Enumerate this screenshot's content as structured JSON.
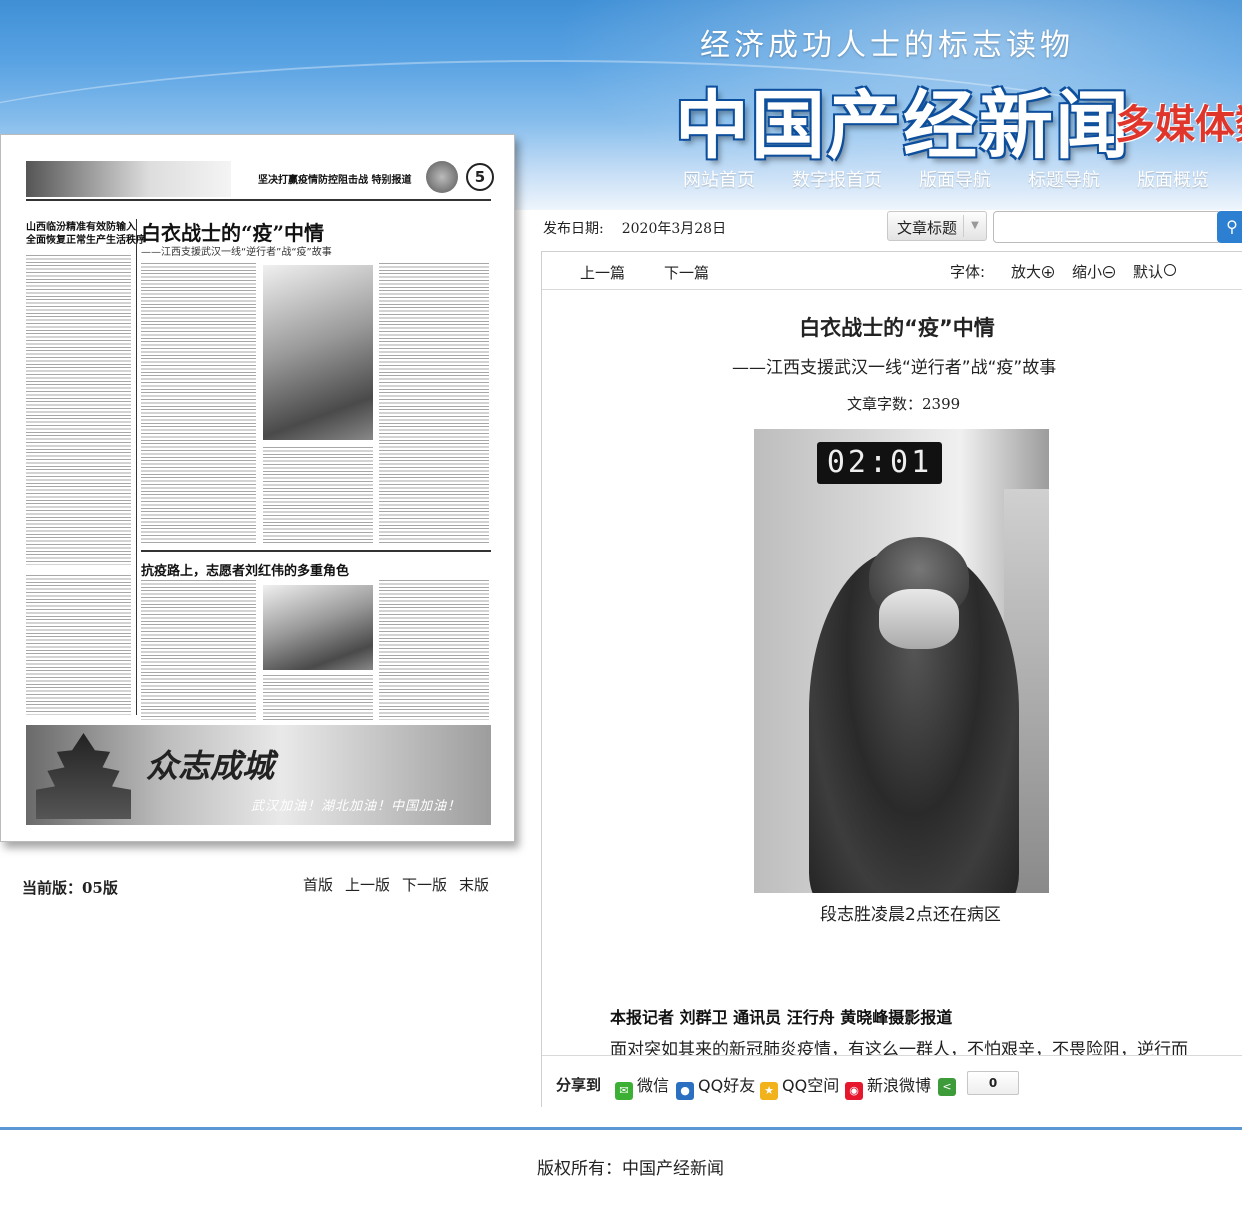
{
  "header": {
    "slogan": "经济成功人士的标志读物",
    "brand": "中国产经新闻",
    "brand_sub": "多媒体数",
    "nav": [
      "网站首页",
      "数字报首页",
      "版面导航",
      "标题导航",
      "版面概览"
    ]
  },
  "paper": {
    "masthead_title": "坚决打赢疫情防控阻击战 特别报道",
    "page_number": "5",
    "lead_story": [
      "山西临汾精准有效防输入",
      "全面恢复正常生产生活秩序"
    ],
    "headline": "白衣战士的“疫”中情",
    "subheadline": "——江西支援武汉一线“逆行者”战“疫”故事",
    "headline2": "抗疫路上，志愿者刘红伟的多重角色",
    "banner_title": "众志成城",
    "banner_slogan": "武汉加油！湖北加油！中国加油！"
  },
  "page_controls": {
    "current": "当前版：05版",
    "first": "首版",
    "prev": "上一版",
    "next": "下一版",
    "last": "末版"
  },
  "search": {
    "publish_label": "发布日期:",
    "publish_date": "2020年3月28日",
    "field_label": "文章标题",
    "query": ""
  },
  "toolbar": {
    "prev": "上一篇",
    "next": "下一篇",
    "font_label": "字体:",
    "zoom_in": "放大",
    "zoom_out": "缩小",
    "default": "默认"
  },
  "article": {
    "title": "白衣战士的“疫”中情",
    "subtitle": "——江西支援武汉一线“逆行者”战“疫”故事",
    "word_count": "文章字数：2399",
    "photo_clock": "02:01",
    "photo_caption": "段志胜凌晨2点还在病区",
    "byline": "本报记者 刘群卫 通讯员 汪行舟 黄晓峰摄影报道",
    "body_first_line": "面对突如其来的新冠肺炎疫情，有这么一群人，不怕艰辛，不畏险阻，逆行而"
  },
  "share": {
    "label": "分享到",
    "items": [
      "微信",
      "QQ好友",
      "QQ空间",
      "新浪微博"
    ],
    "count": "0"
  },
  "footer": {
    "copyright": "版权所有：中国产经新闻"
  },
  "colors": {
    "header_blue": "#3f8fd6",
    "brand_red": "#e0352b",
    "footer_line": "#5b97d4",
    "wechat_green": "#3cb034",
    "weibo_red": "#e6162d"
  }
}
